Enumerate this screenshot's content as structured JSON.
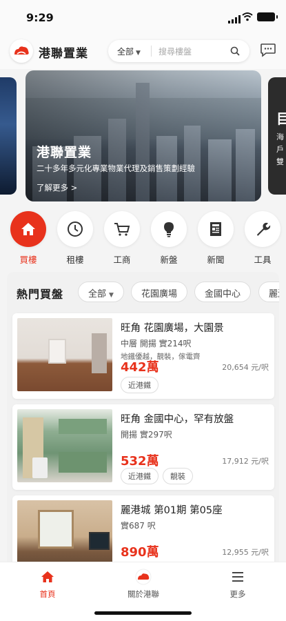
{
  "status_bar": {
    "time": "9:29"
  },
  "header": {
    "brand": "港聯置業",
    "search": {
      "filter_label": "全部",
      "placeholder": "搜尋樓盤"
    }
  },
  "banner": {
    "title": "港聯置業",
    "subtitle": "二十多年多元化專業物業代理及銷售策劃經驗",
    "more": "了解更多 >",
    "right_peek_title": "目",
    "right_peek_text": "海戶雙"
  },
  "categories": [
    {
      "label": "買樓",
      "icon": "home-icon",
      "active": true
    },
    {
      "label": "租樓",
      "icon": "clock-icon",
      "active": false
    },
    {
      "label": "工商",
      "icon": "cart-icon",
      "active": false
    },
    {
      "label": "新盤",
      "icon": "lightbulb-icon",
      "active": false
    },
    {
      "label": "新聞",
      "icon": "newspaper-icon",
      "active": false
    },
    {
      "label": "工具",
      "icon": "wrench-icon",
      "active": false
    }
  ],
  "hot_listings": {
    "title": "熱門買盤",
    "filters": [
      "全部",
      "花園廣場",
      "金國中心",
      "麗港"
    ],
    "items": [
      {
        "title": "旺角 花園廣場，大園景",
        "meta": "中層 開揚 實214呎",
        "desc": "地鐵優越，靚裝，傢電齊",
        "price": "442萬",
        "unit_price": "20,654 元/呎",
        "tags": [
          "近港鐵"
        ]
      },
      {
        "title": "旺角 金國中心，罕有放盤",
        "meta": "開揚 實297呎",
        "desc": "",
        "price": "532萬",
        "unit_price": "17,912 元/呎",
        "tags": [
          "近港鐵",
          "靚裝"
        ]
      },
      {
        "title": "麗港城 第01期 第05座",
        "meta": "實687 呎",
        "desc": "",
        "price": "890萬",
        "unit_price": "12,955 元/呎",
        "tags": []
      }
    ]
  },
  "bottom_nav": [
    {
      "label": "首頁",
      "icon": "home-icon",
      "active": true
    },
    {
      "label": "關於港聯",
      "icon": "logo-icon",
      "active": false
    },
    {
      "label": "更多",
      "icon": "menu-icon",
      "active": false
    }
  ],
  "colors": {
    "accent": "#e8321c",
    "background": "#f4f4f4"
  }
}
